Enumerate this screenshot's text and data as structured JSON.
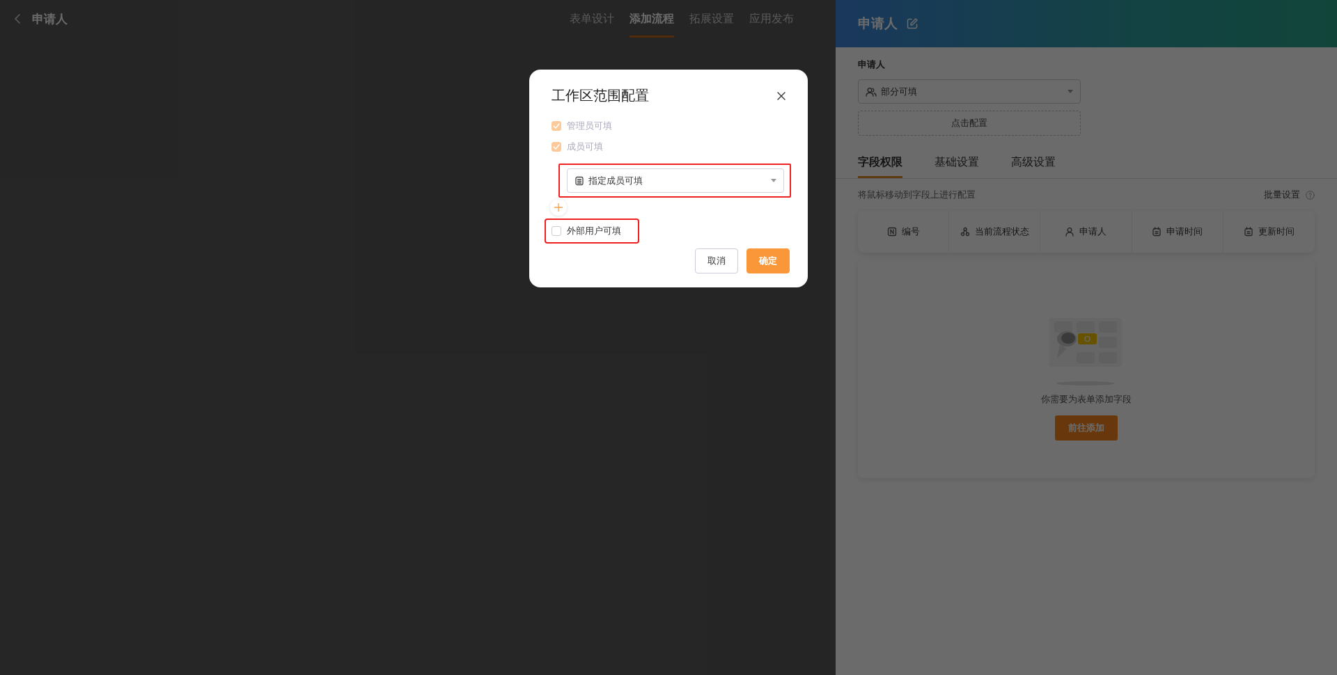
{
  "top_bar": {
    "title": "申请人",
    "steps": [
      {
        "label": "表单设计",
        "selected": false
      },
      {
        "label": "添加流程",
        "selected": true
      },
      {
        "label": "拓展设置",
        "selected": false
      },
      {
        "label": "应用发布",
        "selected": false
      }
    ]
  },
  "side_panel": {
    "title": "申请人",
    "field_label": "申请人",
    "permission_select": {
      "value": "部分可填"
    },
    "config_button": "点击配置",
    "tabs": [
      {
        "label": "字段权限",
        "selected": true
      },
      {
        "label": "基础设置",
        "selected": false
      },
      {
        "label": "高级设置",
        "selected": false
      }
    ],
    "hint": "将鼠标移动到字段上进行配置",
    "batch_button": "批量设置",
    "fields": [
      {
        "label": "编号",
        "kind": "number"
      },
      {
        "label": "当前流程状态",
        "kind": "flow"
      },
      {
        "label": "申请人",
        "kind": "person"
      },
      {
        "label": "申请时间",
        "kind": "date"
      },
      {
        "label": "更新时间",
        "kind": "date"
      }
    ],
    "empty_state": {
      "message": "你需要为表单添加字段",
      "button": "前往添加"
    }
  },
  "dialog": {
    "title": "工作区范围配置",
    "options": [
      {
        "label": "管理员可填",
        "checked": true,
        "disabled": true
      },
      {
        "label": "成员可填",
        "checked": true,
        "disabled": true
      }
    ],
    "member_select": {
      "value": "指定成员可填",
      "highlighted": true
    },
    "external_option": {
      "label": "外部用户可填",
      "checked": false,
      "highlighted": true
    },
    "buttons": [
      {
        "label": "取消",
        "kind": "secondary"
      },
      {
        "label": "确定",
        "kind": "primary"
      }
    ]
  }
}
